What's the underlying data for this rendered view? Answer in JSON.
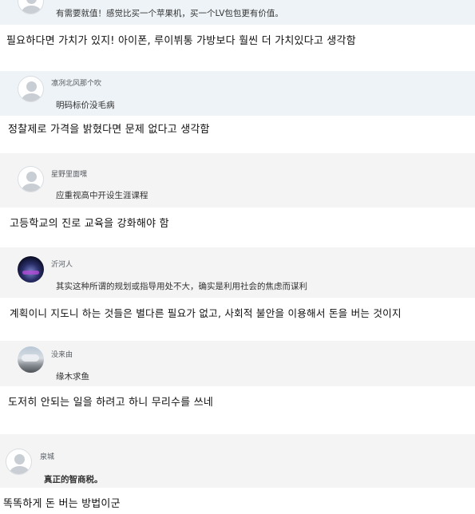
{
  "comments": [
    {
      "user": "",
      "original": "有需要就值！感觉比买一个苹果机，买一个LV包包更有价值。",
      "translation": "필요하다면 가치가 있지! 아이폰, 루이뷔통 가방보다 훨씬 더 가치있다고 생각함",
      "avatar": "default-avatar-icon"
    },
    {
      "user": "凛冽北风那个吹",
      "original": "明码标价没毛病",
      "translation": "정찰제로 가격을 밝혔다면 문제 없다고 생각함",
      "avatar": "default-avatar-icon"
    },
    {
      "user": "星野里面嘿",
      "original": "应重视高中开设生涯课程",
      "translation": "고등학교의 진로 교육을 강화해야 함",
      "avatar": "default-avatar-icon"
    },
    {
      "user": "沂河人",
      "original": "其实这种所谓的规划或指导用处不大，确实是利用社会的焦虑而谋利",
      "translation": "계획이니 지도니 하는 것들은 별다른 필요가 없고, 사회적 불안을 이용해서 돈을 버는 것이지",
      "avatar": "night-sky-avatar"
    },
    {
      "user": "没来由",
      "original": "缘木求鱼",
      "translation": "도저히 안되는 일을 하려고 하니 무리수를 쓰네",
      "avatar": "cloud-sky-avatar"
    },
    {
      "user": "泉城",
      "original": "真正的智商税。",
      "translation": "똑똑하게 돈 버는 방법이군",
      "avatar": "default-avatar-icon"
    }
  ]
}
